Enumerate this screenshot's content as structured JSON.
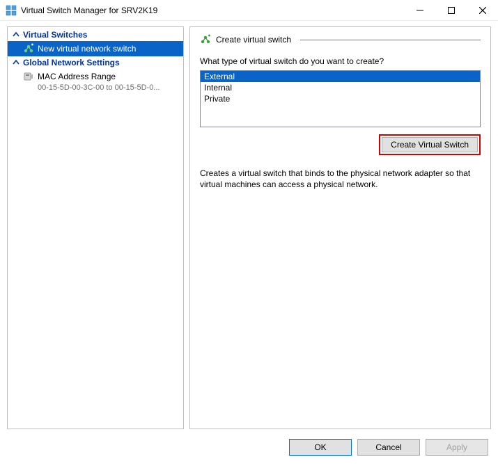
{
  "window": {
    "title": "Virtual Switch Manager for SRV2K19"
  },
  "tree": {
    "section1": {
      "label": "Virtual Switches"
    },
    "item_new_switch": {
      "label": "New virtual network switch"
    },
    "section2": {
      "label": "Global Network Settings"
    },
    "item_mac": {
      "label": "MAC Address Range",
      "sub": "00-15-5D-00-3C-00 to 00-15-5D-0..."
    }
  },
  "pane": {
    "section_title": "Create virtual switch",
    "prompt": "What type of virtual switch do you want to create?",
    "options": {
      "0": "External",
      "1": "Internal",
      "2": "Private"
    },
    "create_btn": "Create Virtual Switch",
    "description": "Creates a virtual switch that binds to the physical network adapter so that virtual machines can access a physical network."
  },
  "buttons": {
    "ok": "OK",
    "cancel": "Cancel",
    "apply": "Apply"
  }
}
